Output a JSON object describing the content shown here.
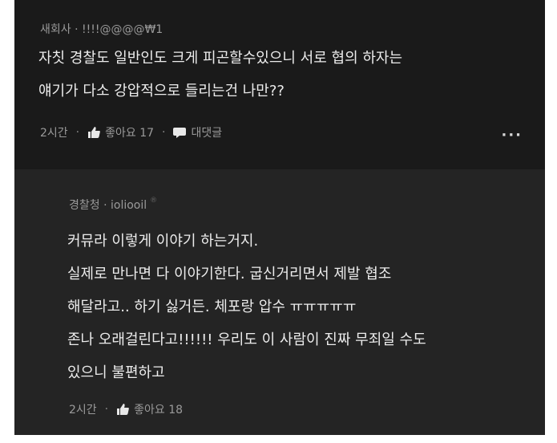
{
  "post": {
    "author_meta": "새회사 · !!!!@@@@₩1",
    "lines": [
      "자칫 경찰도 일반인도 크게 피곤할수있으니 서로 협의 하자는",
      "얘기가 다소 강압적으로 들리는건 나만??"
    ],
    "time": "2시간",
    "like_label": "좋아요 17",
    "comment_label": "대댓글",
    "more_label": "···"
  },
  "reply": {
    "author_meta": "경찰청 · ioliooil",
    "lines": [
      "커뮤라 이렇게 이야기 하는거지.",
      "실제로 만나면 다 이야기한다. 굽신거리면서 제발 협조",
      "해달라고.. 하기 싫거든. 체포랑 압수 ㅠㅠㅠㅠㅠ",
      "존나 오래걸린다고!!!!!! 우리도 이 사람이 진짜 무죄일 수도",
      "있으니 불편하고"
    ],
    "time": "2시간",
    "like_label": "좋아요 18"
  }
}
